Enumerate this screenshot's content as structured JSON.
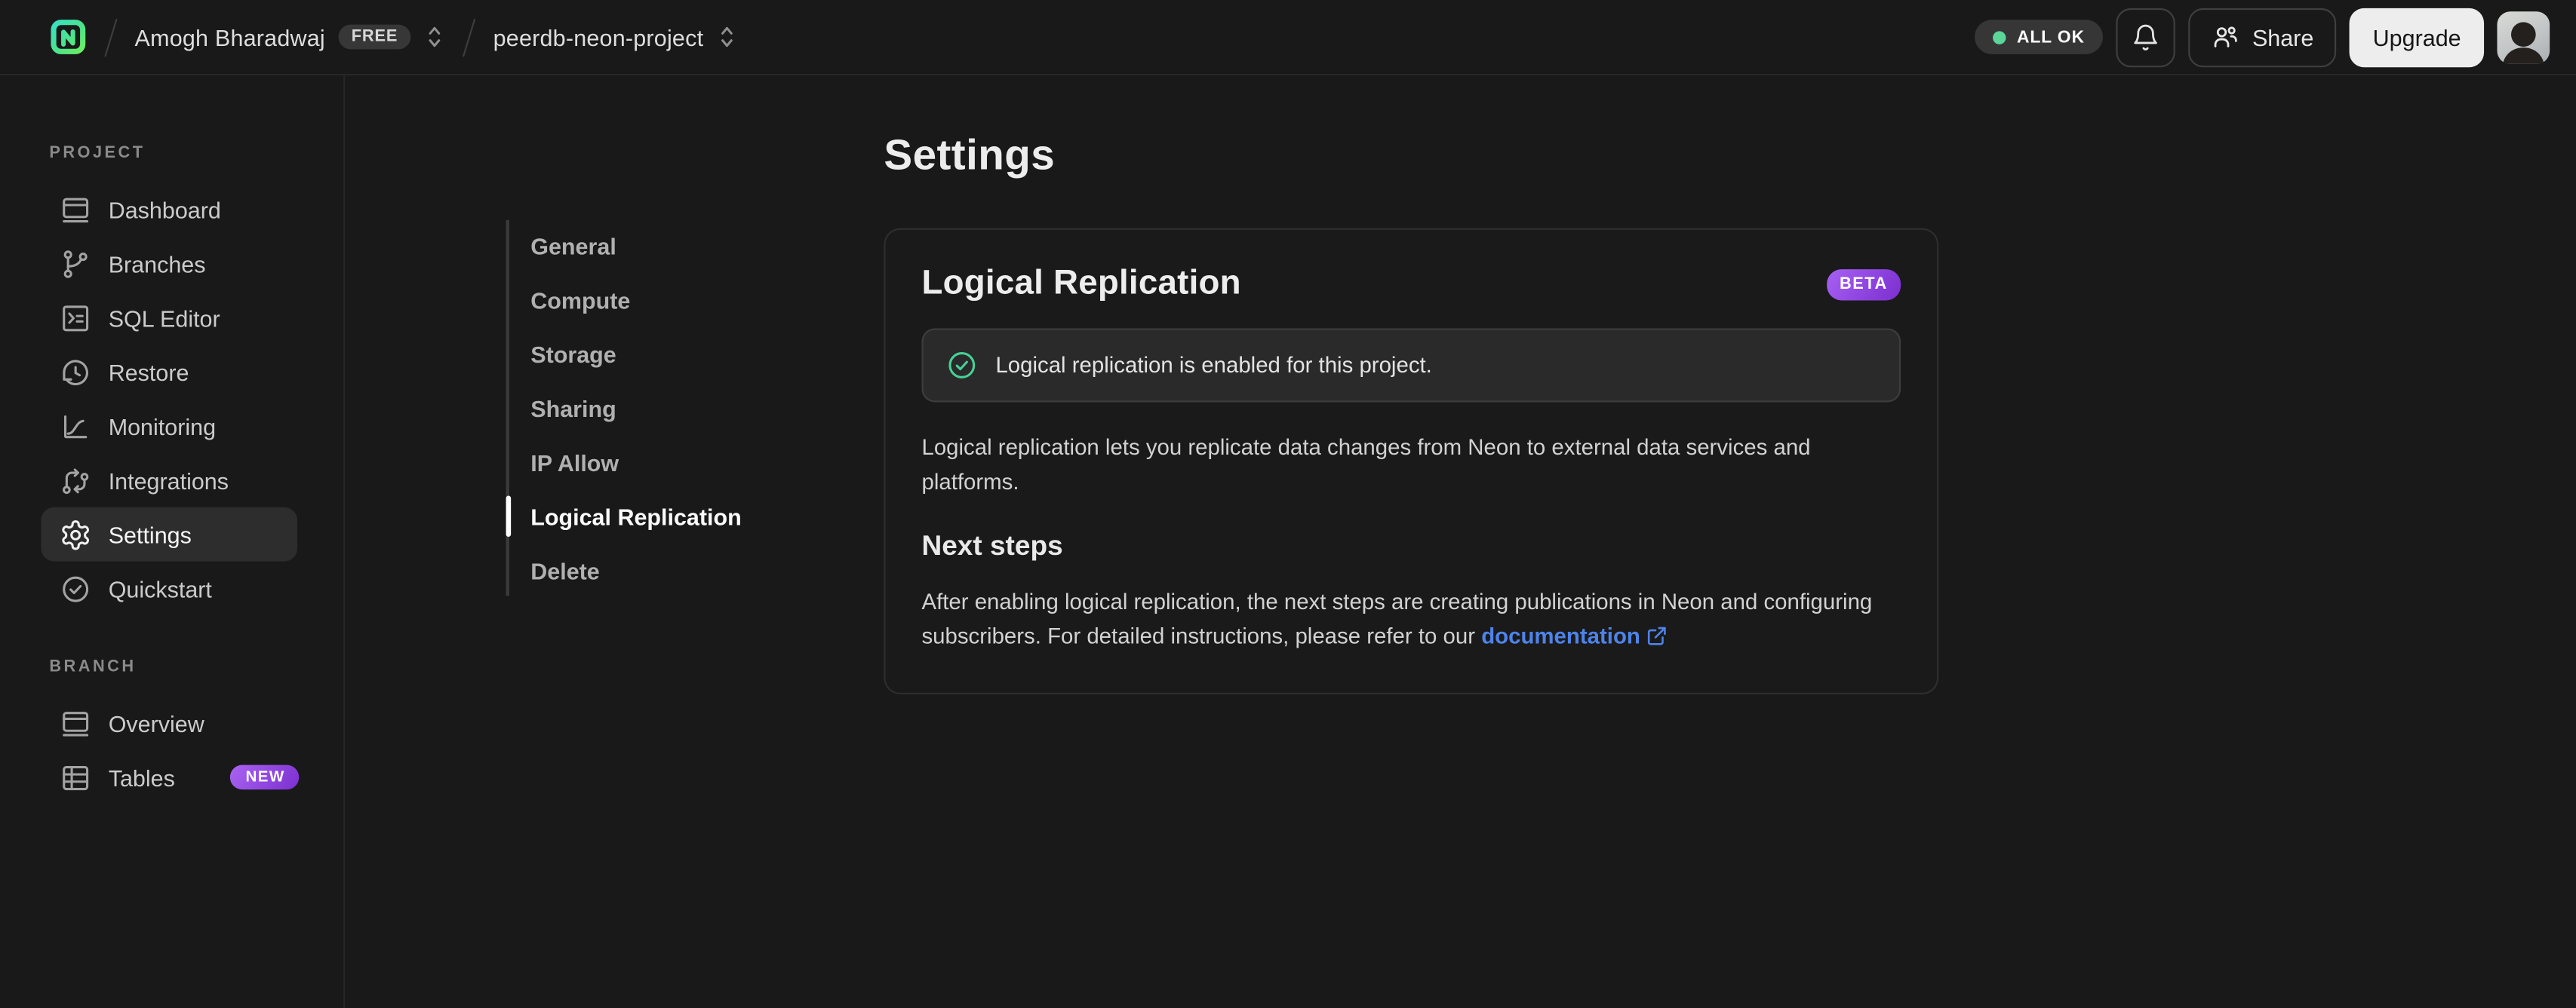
{
  "topbar": {
    "org_name": "Amogh Bharadwaj",
    "org_plan_badge": "FREE",
    "project_name": "peerdb-neon-project",
    "status_label": "ALL OK",
    "share_label": "Share",
    "upgrade_label": "Upgrade"
  },
  "sidebar": {
    "project_section_label": "PROJECT",
    "project_items": [
      {
        "label": "Dashboard"
      },
      {
        "label": "Branches"
      },
      {
        "label": "SQL Editor"
      },
      {
        "label": "Restore"
      },
      {
        "label": "Monitoring"
      },
      {
        "label": "Integrations"
      },
      {
        "label": "Settings"
      },
      {
        "label": "Quickstart"
      }
    ],
    "branch_section_label": "BRANCH",
    "branch_items": [
      {
        "label": "Overview"
      },
      {
        "label": "Tables",
        "badge": "NEW"
      }
    ]
  },
  "settings_nav": {
    "items": [
      {
        "label": "General"
      },
      {
        "label": "Compute"
      },
      {
        "label": "Storage"
      },
      {
        "label": "Sharing"
      },
      {
        "label": "IP Allow"
      },
      {
        "label": "Logical Replication"
      },
      {
        "label": "Delete"
      }
    ],
    "active": "Logical Replication"
  },
  "main": {
    "page_title": "Settings",
    "card": {
      "title": "Logical Replication",
      "badge": "BETA",
      "alert_text": "Logical replication is enabled for this project.",
      "description": "Logical replication lets you replicate data changes from Neon to external data services and platforms.",
      "next_steps_title": "Next steps",
      "next_steps_text": "After enabling logical replication, the next steps are creating publications in Neon and configuring subscribers. For detailed instructions, please refer to our",
      "link_label": "documentation"
    }
  },
  "colors": {
    "background": "#191919",
    "border": "#272727",
    "accent_green": "#5bd598",
    "check_green": "#46d197",
    "badge_purple_from": "#a964f2",
    "badge_purple_to": "#7c2fd0",
    "link_blue": "#4e83e9",
    "active_row": "#2d2d2d",
    "upgrade_bg": "#ededed"
  }
}
